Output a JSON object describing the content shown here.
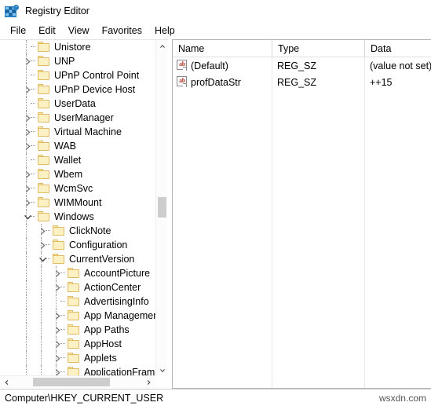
{
  "window": {
    "title": "Registry Editor",
    "icon": "registry-editor-icon"
  },
  "menu": {
    "items": [
      {
        "label": "File"
      },
      {
        "label": "Edit"
      },
      {
        "label": "View"
      },
      {
        "label": "Favorites"
      },
      {
        "label": "Help"
      }
    ]
  },
  "tree": {
    "rows": [
      {
        "label": "Unistore",
        "level": 1,
        "state": "leaf"
      },
      {
        "label": "UNP",
        "level": 1,
        "state": "collapsed"
      },
      {
        "label": "UPnP Control Point",
        "level": 1,
        "state": "leaf"
      },
      {
        "label": "UPnP Device Host",
        "level": 1,
        "state": "collapsed"
      },
      {
        "label": "UserData",
        "level": 1,
        "state": "leaf"
      },
      {
        "label": "UserManager",
        "level": 1,
        "state": "collapsed"
      },
      {
        "label": "Virtual Machine",
        "level": 1,
        "state": "collapsed"
      },
      {
        "label": "WAB",
        "level": 1,
        "state": "collapsed"
      },
      {
        "label": "Wallet",
        "level": 1,
        "state": "leaf"
      },
      {
        "label": "Wbem",
        "level": 1,
        "state": "collapsed"
      },
      {
        "label": "WcmSvc",
        "level": 1,
        "state": "collapsed"
      },
      {
        "label": "WIMMount",
        "level": 1,
        "state": "collapsed"
      },
      {
        "label": "Windows",
        "level": 1,
        "state": "expanded"
      },
      {
        "label": "ClickNote",
        "level": 2,
        "state": "collapsed"
      },
      {
        "label": "Configuration",
        "level": 2,
        "state": "collapsed"
      },
      {
        "label": "CurrentVersion",
        "level": 2,
        "state": "expanded"
      },
      {
        "label": "AccountPicture",
        "level": 3,
        "state": "collapsed"
      },
      {
        "label": "ActionCenter",
        "level": 3,
        "state": "collapsed"
      },
      {
        "label": "AdvertisingInfo",
        "level": 3,
        "state": "leaf"
      },
      {
        "label": "App Management",
        "level": 3,
        "state": "collapsed"
      },
      {
        "label": "App Paths",
        "level": 3,
        "state": "collapsed"
      },
      {
        "label": "AppHost",
        "level": 3,
        "state": "collapsed"
      },
      {
        "label": "Applets",
        "level": 3,
        "state": "collapsed"
      },
      {
        "label": "ApplicationFram",
        "level": 3,
        "state": "collapsed"
      }
    ],
    "scroll_up_icon": "chevron-up-icon",
    "scroll_down_icon": "chevron-down-icon",
    "scroll_left_icon": "chevron-left-icon",
    "scroll_right_icon": "chevron-right-icon"
  },
  "values": {
    "columns": [
      "Name",
      "Type",
      "Data"
    ],
    "rows": [
      {
        "name": "(Default)",
        "type": "REG_SZ",
        "data": "(value not set)",
        "icon": "string-value-icon"
      },
      {
        "name": "profDataStr",
        "type": "REG_SZ",
        "data": "++15",
        "icon": "string-value-icon"
      }
    ]
  },
  "status": {
    "path": "Computer\\HKEY_CURRENT_USER",
    "watermark": "wsxdn.com"
  },
  "colors": {
    "folder_fill": "#fdf0c2",
    "folder_border": "#e0bb63",
    "accent": "#2a7fc4",
    "value_icon_text": "#b03a2e"
  }
}
